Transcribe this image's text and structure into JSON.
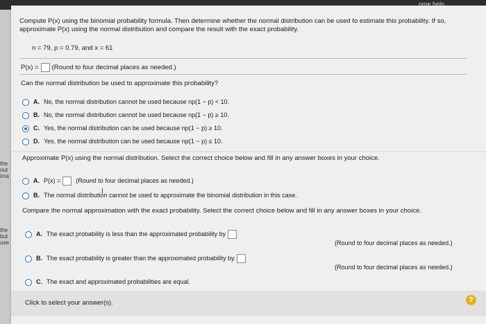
{
  "header": {
    "right_text": "...ome help"
  },
  "problem": {
    "instruction": "Compute P(x) using the binomial probability formula. Then determine whether the normal distribution can be used to estimate this probability. If so,",
    "instruction2": "approximate P(x) using the normal distribution and compare the result with the exact probability.",
    "params": "n = 79, p = 0.79, and x = 61"
  },
  "q1": {
    "label": "P(x) =",
    "hint": "(Round to four decimal places as needed.)"
  },
  "q2": {
    "prompt": "Can the normal distribution be used to approximate this probability?",
    "options": [
      {
        "letter": "A.",
        "text": "No, the normal distribution cannot be used because np(1 − p) < 10.",
        "selected": false
      },
      {
        "letter": "B.",
        "text": "No, the normal distribution cannot be used because np(1 − p) ≥ 10.",
        "selected": false
      },
      {
        "letter": "C.",
        "text": "Yes, the normal distribution can be used because np(1 − p) ≥ 10.",
        "selected": true
      },
      {
        "letter": "D.",
        "text": "Yes, the normal distribution can be used because np(1 − p) ≤ 10.",
        "selected": false
      }
    ]
  },
  "q3": {
    "prompt": "Approximate P(x) using the normal distribution. Select the correct choice below and fill in any answer boxes in your choice.",
    "optA_label": "P(x) =",
    "optA_hint": "(Round to four decimal places as needed.)",
    "optB_text": "The normal distribution cannot be used to approximate the binomial distribution in this case.",
    "letters": [
      "A.",
      "B."
    ]
  },
  "q4": {
    "prompt": "Compare the normal approximation with the exact probability. Select the correct choice below and fill in any answer boxes in your choice.",
    "optA": "The exact probability is less than the approximated probability by",
    "optB": "The exact probability is greater than the approximated probability by",
    "optC": "The exact and approximated probabilities are equal.",
    "hint": "(Round to four decimal places as needed.)",
    "letters": [
      "A.",
      "B.",
      "C."
    ]
  },
  "footer": {
    "status": "Click to select your answer(s).",
    "help": "?"
  },
  "left_edge": [
    "the",
    "out",
    "ima",
    "the",
    "but",
    "use"
  ]
}
